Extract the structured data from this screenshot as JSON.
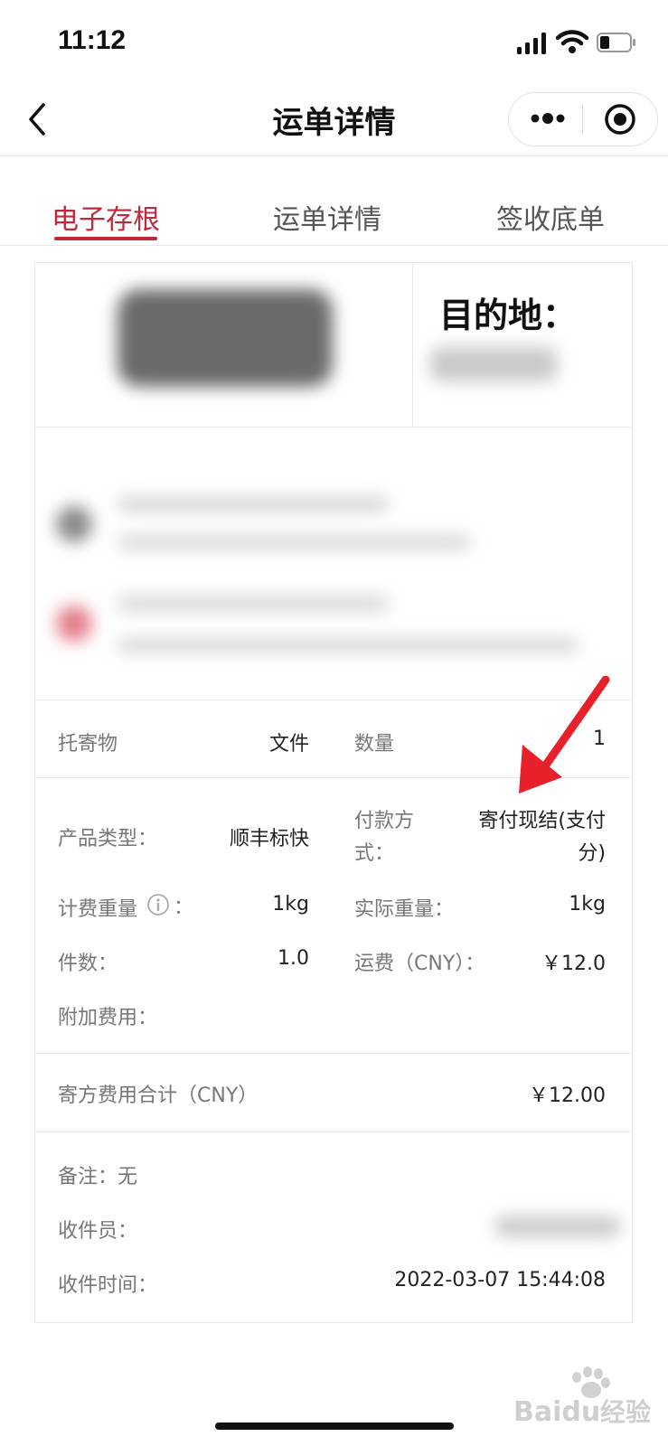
{
  "status_bar": {
    "time": "11:12"
  },
  "nav": {
    "title": "运单详情"
  },
  "tabs": [
    {
      "label": "电子存根"
    },
    {
      "label": "运单详情"
    },
    {
      "label": "签收底单"
    }
  ],
  "waybill": {
    "destination_label": "目的地："
  },
  "goods": {
    "label": "托寄物",
    "value": "文件",
    "qty_label": "数量",
    "qty_value": "1"
  },
  "details": {
    "product_type_label": "产品类型：",
    "product_type_value": "顺丰标快",
    "payment_label_1": "付款方",
    "payment_label_2": "式：",
    "payment_value_1": "寄付现结(支付",
    "payment_value_2": "分)",
    "billing_weight_label": "计费重量",
    "billing_weight_value": "1kg",
    "actual_weight_label": "实际重量：",
    "actual_weight_value": "1kg",
    "pieces_label": "件数：",
    "pieces_value": "1.0",
    "freight_label": "运费（CNY）：",
    "freight_value": "￥12.0",
    "extra_fee_label": "附加费用："
  },
  "total": {
    "label": "寄方费用合计（CNY）",
    "value": "￥12.00"
  },
  "footer": {
    "remark": "备注：无",
    "courier_label": "收件员：",
    "time_label": "收件时间：",
    "time_value": "2022-03-07 15:44:08"
  },
  "watermark": {
    "text": "经验",
    "brand": "Baidu"
  },
  "colors": {
    "accent": "#c1283c",
    "arrow": "#e8202a"
  }
}
